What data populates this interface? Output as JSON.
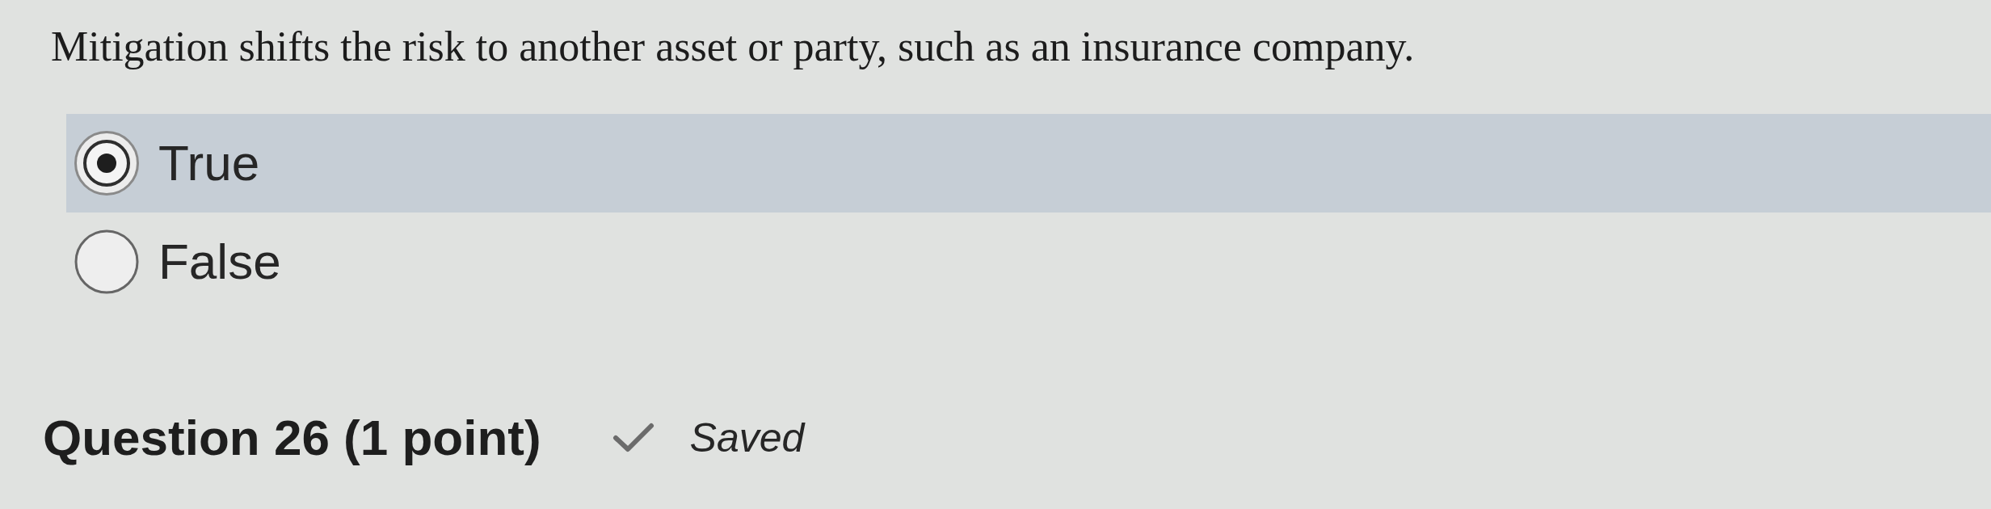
{
  "question": {
    "text": "Mitigation shifts the risk to another asset or party, such as an insurance company."
  },
  "options": [
    {
      "label": "True",
      "selected": true
    },
    {
      "label": "False",
      "selected": false
    }
  ],
  "next_question": {
    "title": "Question 26 (1 point)",
    "status": "Saved"
  }
}
